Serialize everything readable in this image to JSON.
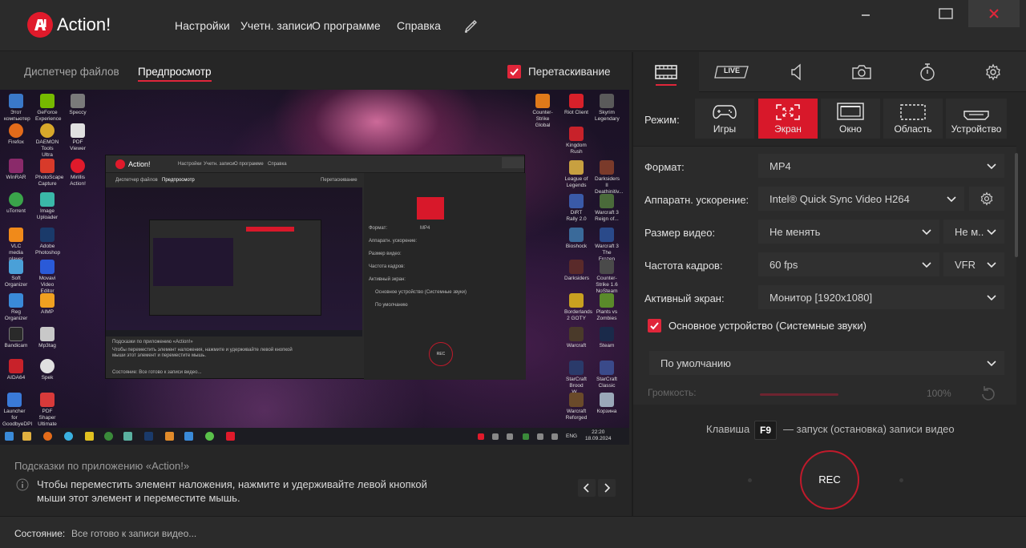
{
  "app": {
    "name": "Action!"
  },
  "menu": {
    "items": [
      "Настройки",
      "Учетн. записи",
      "О программе",
      "Справка"
    ]
  },
  "left_tabs": {
    "file_manager": "Диспетчер файлов",
    "preview": "Предпросмотр"
  },
  "drag": {
    "label": "Перетаскивание",
    "checked": true
  },
  "hints": {
    "title": "Подсказки по приложению «Action!»",
    "text": "Чтобы переместить элемент наложения, нажмите и удерживайте левой кнопкой мыши этот элемент и переместите мышь."
  },
  "right_tabs": {
    "live_label": "LIVE"
  },
  "mode": {
    "label": "Режим:",
    "options": [
      "Игры",
      "Экран",
      "Окно",
      "Область",
      "Устройство"
    ],
    "active": "Экран"
  },
  "settings": {
    "format": {
      "label": "Формат:",
      "value": "MP4"
    },
    "hw_accel": {
      "label": "Аппаратн. ускорение:",
      "value": "Intel® Quick Sync Video H264"
    },
    "video_size": {
      "label": "Размер видео:",
      "value": "Не менять",
      "value2": "Не м..."
    },
    "frame_rate": {
      "label": "Частота кадров:",
      "value": "60 fps",
      "value2": "VFR"
    },
    "active_screen": {
      "label": "Активный экран:",
      "value": "Монитор [1920x1080]"
    },
    "primary_device": {
      "label": "Основное устройство (Системные звуки)",
      "checked": true
    },
    "device": {
      "value": "По умолчанию"
    },
    "volume": {
      "label": "Громкость:",
      "value": "100%"
    }
  },
  "hotkey": {
    "prefix": "Клавиша",
    "key": "F9",
    "suffix": "— запуск (остановка) записи видео"
  },
  "rec": {
    "label": "REC"
  },
  "status": {
    "label": "Состояние:",
    "value": "Все готово к записи видео..."
  },
  "preview_desktop": {
    "icons_left": [
      "Этот компьютер",
      "Firefox",
      "WinRAR",
      "uTorrent",
      "VLC media player",
      "Soft Organizer",
      "Reg Organizer",
      "Bandicam",
      "AIDA64",
      "Launcher for GoodbyeDPI"
    ],
    "icons_left2": [
      "GeForce Experience",
      "DAEMON Tools Ultra",
      "PhotoScape Capture",
      "Image Uploader",
      "Adobe Photoshop",
      "Movavi Video Editor",
      "AIMP",
      "Mp3tag",
      "Spek",
      "PDF Shaper Ultimate"
    ],
    "icons_left3": [
      "Speccy",
      "PDF Viewer",
      "Mirillis Action!"
    ],
    "icons_right": [
      "Counter-Strike Global",
      "Kingdom Rush",
      "League of Legends",
      "DiRT Rally 2.0",
      "Bioshock",
      "Darksiders",
      "Borderlands 2 GOTY",
      "Warcraft",
      "StarCraft Brood W...",
      "Warcraft Reforged"
    ],
    "icons_right2": [
      "Riot Client",
      "Skyrim Legendary",
      "Darksiders II Deathinitiv...",
      "Warcraft 3 Reign of...",
      "Warcraft 3 The Frozen",
      "Counter-Strike 1.6 NoSteam",
      "Plants vs Zombies",
      "Steam",
      "StarCraft Classic",
      "Корзина"
    ],
    "clock_time": "22:20",
    "clock_date": "18.09.2024",
    "lang": "ENG"
  },
  "colors": {
    "accent": "#e0263a",
    "active_mode": "#d8182a",
    "panel": "#2b2b2b"
  }
}
